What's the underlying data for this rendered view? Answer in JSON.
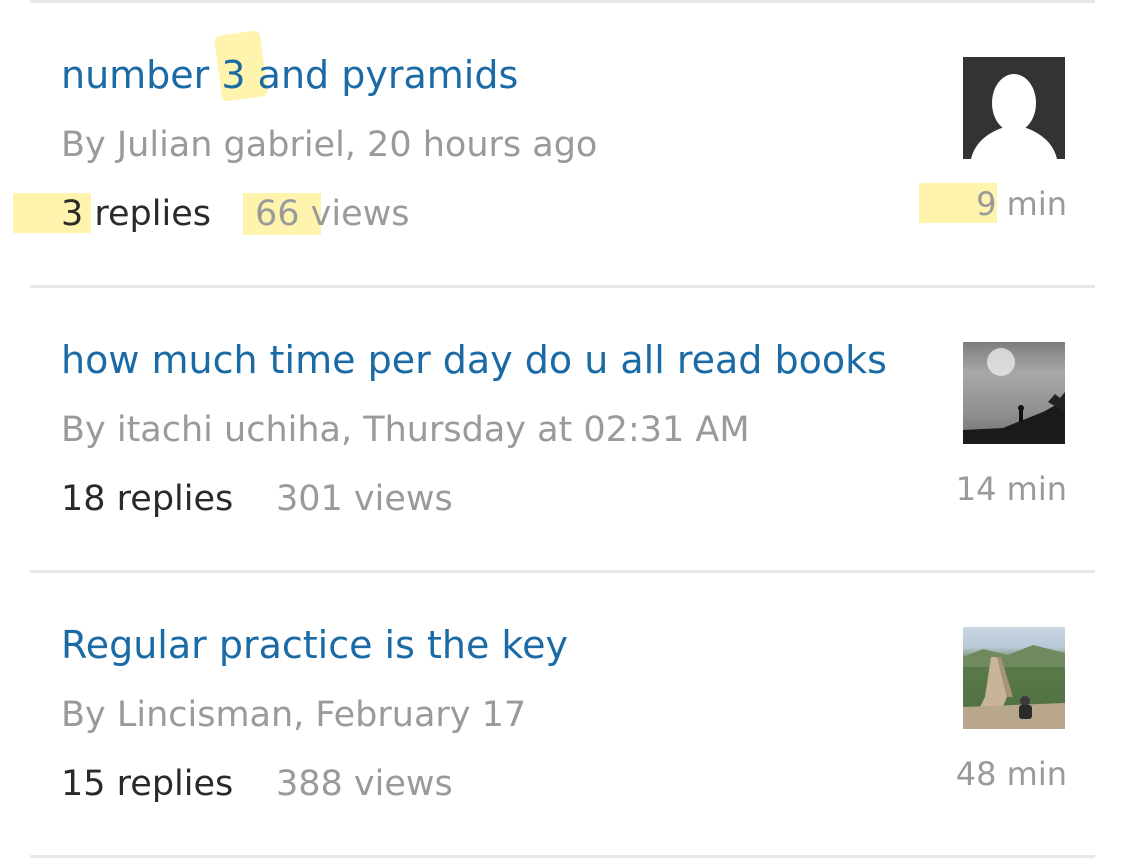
{
  "topics": [
    {
      "title_parts": [
        "number ",
        "3",
        " and pyramids"
      ],
      "byline": "By Julian gabriel, 20 hours ago",
      "replies_count": "3",
      "replies_label": " replies",
      "views_parts": [
        "66 v",
        "iews"
      ],
      "read_time_parts": [
        "9",
        " min"
      ],
      "avatar": "default-user-silhouette-icon"
    },
    {
      "title": "how much time per day do u all read books",
      "byline": "By itachi uchiha, Thursday at 02:31 AM",
      "replies": "18 replies",
      "views": "301 views",
      "read_time": "14 min",
      "avatar": "silhouette-in-fog-photo"
    },
    {
      "title": "Regular practice is the key",
      "byline": "By Lincisman, February 17",
      "replies": "15 replies",
      "views": "388 views",
      "read_time": "48 min",
      "avatar": "great-wall-photo"
    }
  ],
  "colors": {
    "title": "#1a6aa6",
    "meta": "#9a9a9a",
    "replies": "#2a2a2a",
    "highlight": "#ffee82",
    "divider": "#e8e8e8"
  }
}
